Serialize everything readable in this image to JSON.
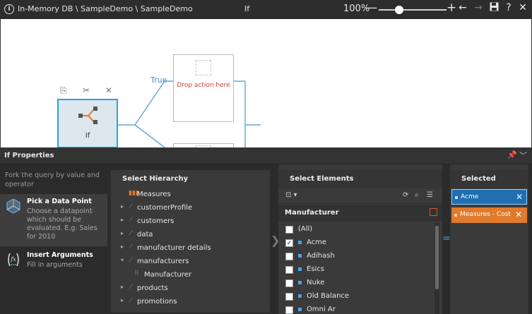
{
  "titlebar": {
    "path": "In-Memory DB \\ SampleDemo \\ SampleDemo",
    "title": "If",
    "zoom": "100%",
    "zoom_minus": "—",
    "zoom_plus": "+",
    "back_icon": "←",
    "forward_icon": "→",
    "help": "?",
    "close": "✕"
  },
  "canvas": {
    "node_label": "If",
    "true_label": "True",
    "drop_action": "Drop action here"
  },
  "properties": {
    "title": "If Properties",
    "description": "Fork the query by value and operator",
    "options": [
      {
        "title": "Pick a Data Point",
        "desc": "Choose a datapoint which should be evaluated. E.g. Sales for 2010"
      },
      {
        "title": "Insert Arguments",
        "desc": "Fill in arguments"
      }
    ],
    "hierarchy": {
      "title": "Select Hierarchy",
      "items": [
        {
          "label": "Measures",
          "arrow": "",
          "icon": "bars"
        },
        {
          "label": "customerProfile",
          "arrow": "▸",
          "icon": "axis"
        },
        {
          "label": "customers",
          "arrow": "▸",
          "icon": "axis"
        },
        {
          "label": "data",
          "arrow": "▸",
          "icon": "axis"
        },
        {
          "label": "manufacturer details",
          "arrow": "▸",
          "icon": "axis"
        },
        {
          "label": "manufacturers",
          "arrow": "▾",
          "icon": "axis"
        },
        {
          "label": "Manufacturer",
          "arrow": "",
          "icon": "levels"
        },
        {
          "label": "products",
          "arrow": "▸",
          "icon": "axis"
        },
        {
          "label": "promotions",
          "arrow": "▸",
          "icon": "axis"
        }
      ]
    },
    "elements": {
      "title": "Select Elements",
      "subtitle": "Manufacturer",
      "items": [
        {
          "label": "(All)",
          "checked": false,
          "all": true
        },
        {
          "label": "Acme",
          "checked": true
        },
        {
          "label": "Adihash",
          "checked": false
        },
        {
          "label": "Esics",
          "checked": false
        },
        {
          "label": "Nuke",
          "checked": false
        },
        {
          "label": "Old Balance",
          "checked": false
        },
        {
          "label": "Omni Ar",
          "checked": false
        }
      ]
    },
    "selected": {
      "title": "Selected",
      "items": [
        {
          "label": "Acme",
          "style": "blue",
          "color": "#1f6fb1"
        },
        {
          "label": "Measures - Cost",
          "style": "orange",
          "color": "#e07b2c"
        }
      ]
    }
  }
}
